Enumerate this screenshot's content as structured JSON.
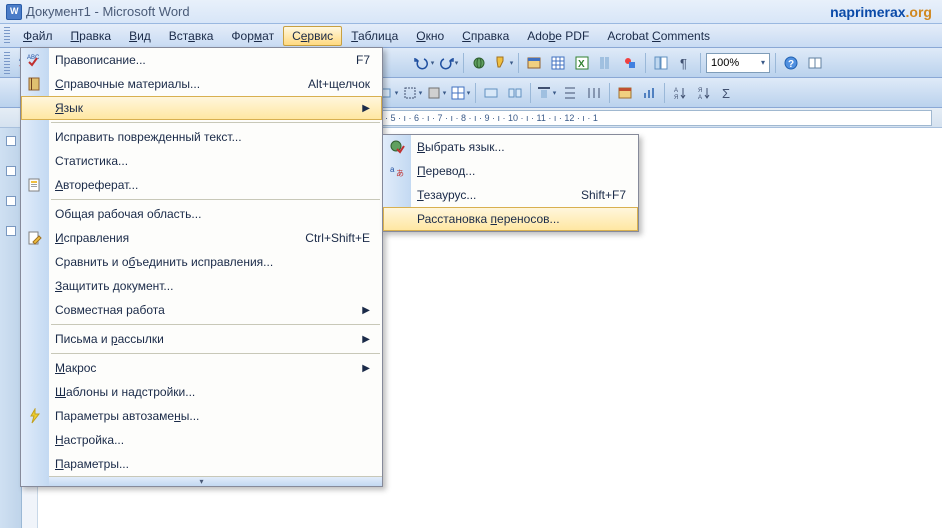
{
  "title": "Документ1 - Microsoft Word",
  "watermark": {
    "a": "naprimerax",
    "b": ".org"
  },
  "menubar": {
    "items": [
      {
        "pre": "",
        "u": "Ф",
        "post": "айл"
      },
      {
        "pre": "",
        "u": "П",
        "post": "равка"
      },
      {
        "pre": "",
        "u": "В",
        "post": "ид"
      },
      {
        "pre": "Вст",
        "u": "а",
        "post": "вка"
      },
      {
        "pre": "Фор",
        "u": "м",
        "post": "ат"
      },
      {
        "pre": "С",
        "u": "е",
        "post": "рвис"
      },
      {
        "pre": "",
        "u": "Т",
        "post": "аблица"
      },
      {
        "pre": "",
        "u": "О",
        "post": "кно"
      },
      {
        "pre": "",
        "u": "С",
        "post": "правка"
      },
      {
        "pre": "Ado",
        "u": "b",
        "post": "e PDF"
      },
      {
        "pre": "Acrobat ",
        "u": "C",
        "post": "omments"
      }
    ]
  },
  "toolbar": {
    "zoom": "100%"
  },
  "ruler_text": "· 5 · ı · 6 · ı · 7 · ı · 8 · ı · 9 · ı · 10 · ı · 11 · ı · 12 · ı · 1",
  "service_menu": [
    {
      "label": "Правописание...",
      "shortcut": "F7",
      "icon": "spellcheck"
    },
    {
      "pre": "",
      "u": "С",
      "post": "правочные материалы...",
      "shortcut": "Alt+щелчок",
      "icon": "book"
    },
    {
      "pre": "",
      "u": "Я",
      "post": "зык",
      "submenu": true,
      "highlight": true
    },
    {
      "sep": true
    },
    {
      "label": "Исправить поврежденный текст..."
    },
    {
      "label": "Статистика..."
    },
    {
      "pre": "",
      "u": "А",
      "post": "втореферат...",
      "icon": "autoref"
    },
    {
      "sep": true
    },
    {
      "label": "Общая рабочая область..."
    },
    {
      "pre": "",
      "u": "И",
      "post": "справления",
      "shortcut": "Ctrl+Shift+E",
      "icon": "track"
    },
    {
      "pre": "Сравнить и о",
      "u": "б",
      "post": "ъединить исправления..."
    },
    {
      "pre": "",
      "u": "З",
      "post": "ащитить документ..."
    },
    {
      "label": "Совместная работа",
      "submenu": true
    },
    {
      "sep": true
    },
    {
      "pre": "Письма и ",
      "u": "р",
      "post": "ассылки",
      "submenu": true
    },
    {
      "sep": true
    },
    {
      "pre": "",
      "u": "М",
      "post": "акрос",
      "submenu": true
    },
    {
      "pre": "",
      "u": "Ш",
      "post": "аблоны и надстройки..."
    },
    {
      "pre": "Параметры автозаме",
      "u": "н",
      "post": "ы...",
      "icon": "bolt"
    },
    {
      "pre": "",
      "u": "Н",
      "post": "астройка..."
    },
    {
      "pre": "",
      "u": "П",
      "post": "араметры..."
    }
  ],
  "lang_menu": [
    {
      "pre": "",
      "u": "В",
      "post": "ыбрать язык...",
      "icon": "globe"
    },
    {
      "pre": "",
      "u": "П",
      "post": "еревод...",
      "icon": "translate"
    },
    {
      "pre": "",
      "u": "Т",
      "post": "езаурус...",
      "shortcut": "Shift+F7"
    },
    {
      "pre": "Расстановка ",
      "u": "п",
      "post": "ереносов...",
      "highlight": true
    }
  ]
}
